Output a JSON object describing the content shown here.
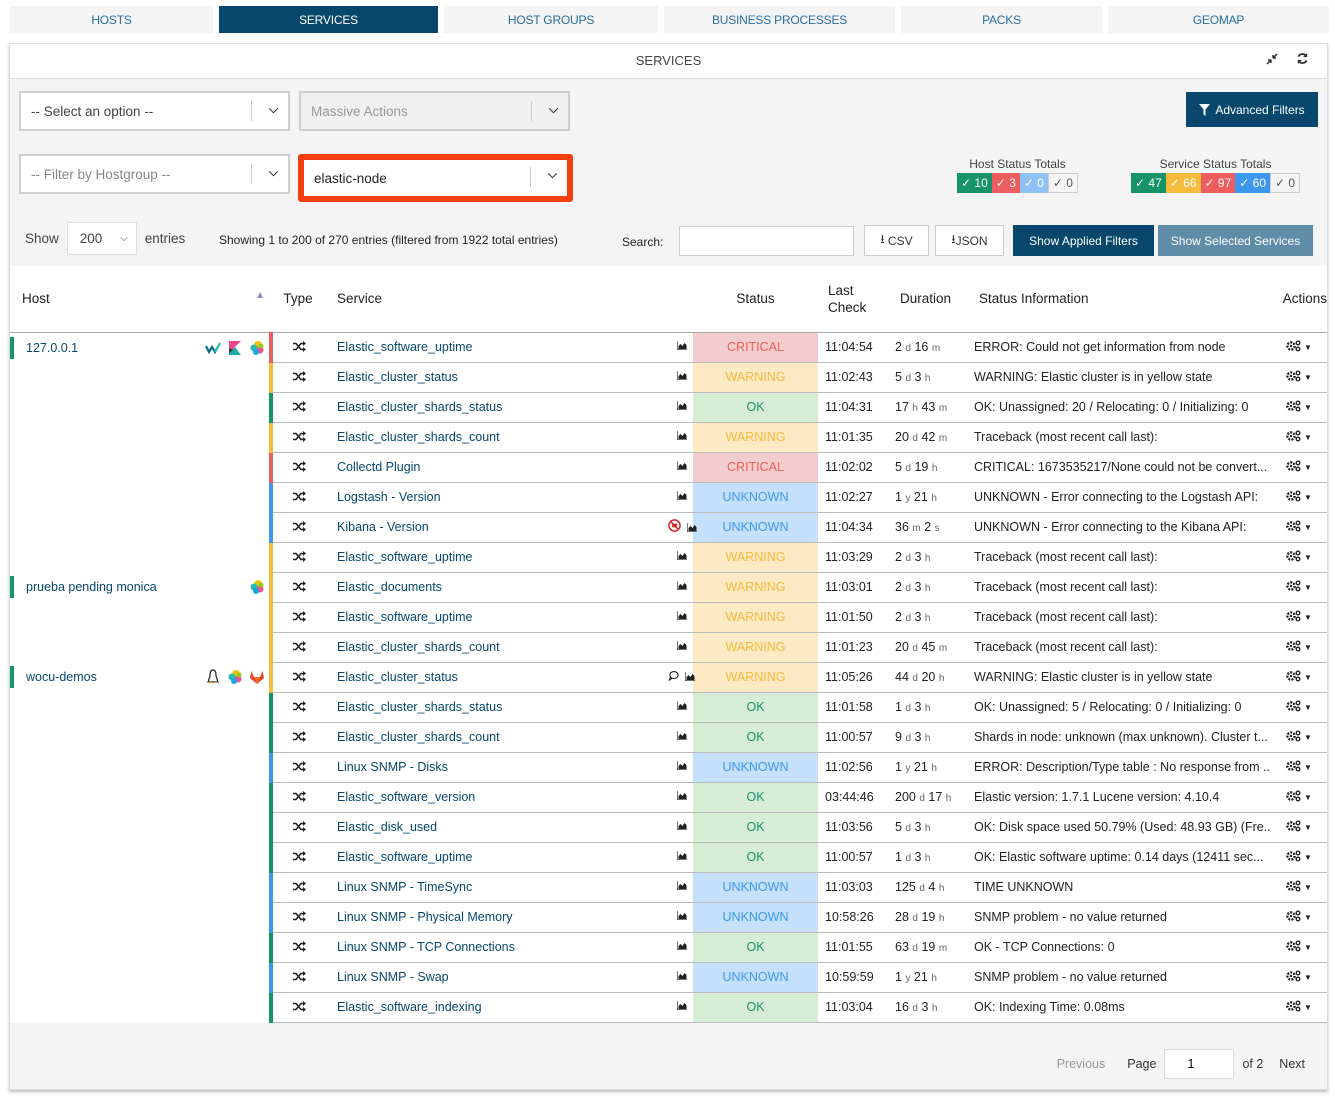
{
  "nav": {
    "tabs": [
      {
        "label": "HOSTS",
        "active": false
      },
      {
        "label": "SERVICES",
        "active": true
      },
      {
        "label": "HOST GROUPS",
        "active": false
      },
      {
        "label": "BUSINESS PROCESSES",
        "active": false
      },
      {
        "label": "PACKS",
        "active": false
      },
      {
        "label": "GEOMAP",
        "active": false
      }
    ]
  },
  "panel": {
    "title": "SERVICES",
    "icons": [
      "compress-icon",
      "refresh-icon"
    ]
  },
  "filters": {
    "select_option": "-- Select an option --",
    "massive_actions": "Massive Actions",
    "hostgroup_placeholder": "-- Filter by Hostgroup --",
    "hostgroup_selected": "elastic-node",
    "advanced_filters_label": "Advanced Filters"
  },
  "host_totals": {
    "title": "Host Status Totals",
    "badges": [
      {
        "status": "up",
        "count": "10",
        "color": "#17936a"
      },
      {
        "status": "down",
        "count": "3",
        "color": "#ee5d5d"
      },
      {
        "status": "unreachable",
        "count": "0",
        "color": "#8ec2f5"
      },
      {
        "status": "pending",
        "count": "0",
        "color": "#f4f4f4"
      }
    ]
  },
  "service_totals": {
    "title": "Service Status Totals",
    "badges": [
      {
        "status": "ok",
        "count": "47",
        "color": "#17936a"
      },
      {
        "status": "warning",
        "count": "66",
        "color": "#f4bb3c"
      },
      {
        "status": "critical",
        "count": "97",
        "color": "#ee5d5d"
      },
      {
        "status": "unknown",
        "count": "60",
        "color": "#3c97ee"
      },
      {
        "status": "pending",
        "count": "0",
        "color": "#f4f4f4"
      }
    ]
  },
  "table_controls": {
    "show_label": "Show",
    "entries_value": "200",
    "entries_label": "entries",
    "info": "Showing 1 to 200 of 270 entries (filtered from 1922 total entries)",
    "search_label": "Search:",
    "search_value": "",
    "csv_label": "CSV",
    "json_label": "JSON",
    "show_applied_filters": "Show Applied Filters",
    "show_selected_services": "Show Selected Services"
  },
  "columns": {
    "host": "Host",
    "type": "Type",
    "service": "Service",
    "status": "Status",
    "last_check_1": "Last",
    "last_check_2": "Check",
    "duration": "Duration",
    "status_information": "Status Information",
    "actions": "Actions"
  },
  "host_groups": [
    {
      "host": "127.0.0.1",
      "icons": [
        "wocu-icon",
        "kibana-icon",
        "elastic-icon"
      ],
      "services": [
        {
          "name": "Elastic_software_uptime",
          "status": "CRITICAL",
          "last_check": "11:04:54",
          "duration": [
            [
              "2",
              "d"
            ],
            [
              "16",
              "m"
            ]
          ],
          "info": "ERROR: Could not get information from node",
          "extra": []
        },
        {
          "name": "Elastic_cluster_status",
          "status": "WARNING",
          "last_check": "11:02:43",
          "duration": [
            [
              "5",
              "d"
            ],
            [
              "3",
              "h"
            ]
          ],
          "info": "WARNING: Elastic cluster is in yellow state",
          "extra": []
        },
        {
          "name": "Elastic_cluster_shards_status",
          "status": "OK",
          "last_check": "11:04:31",
          "duration": [
            [
              "17",
              "h"
            ],
            [
              "43",
              "m"
            ]
          ],
          "info": "OK: Unassigned: 20 / Relocating: 0 / Initializing: 0",
          "extra": []
        },
        {
          "name": "Elastic_cluster_shards_count",
          "status": "WARNING",
          "last_check": "11:01:35",
          "duration": [
            [
              "20",
              "d"
            ],
            [
              "42",
              "m"
            ]
          ],
          "info": "Traceback (most recent call last):",
          "extra": []
        },
        {
          "name": "Collectd Plugin",
          "status": "CRITICAL",
          "last_check": "11:02:02",
          "duration": [
            [
              "5",
              "d"
            ],
            [
              "19",
              "h"
            ]
          ],
          "info": "CRITICAL: 1673535217/None could not be convert...",
          "extra": []
        },
        {
          "name": "Logstash - Version",
          "status": "UNKNOWN",
          "last_check": "11:02:27",
          "duration": [
            [
              "1",
              "y"
            ],
            [
              "21",
              "h"
            ]
          ],
          "info": "UNKNOWN - Error connecting to the Logstash API:",
          "extra": []
        },
        {
          "name": "Kibana - Version",
          "status": "UNKNOWN",
          "last_check": "11:04:34",
          "duration": [
            [
              "36",
              "m"
            ],
            [
              "2",
              "s"
            ]
          ],
          "info": "UNKNOWN - Error connecting to the Kibana API:",
          "extra": [
            "notifications-disabled-icon"
          ]
        },
        {
          "name": "Elastic_software_uptime",
          "status": "WARNING",
          "last_check": "11:03:29",
          "duration": [
            [
              "2",
              "d"
            ],
            [
              "3",
              "h"
            ]
          ],
          "info": "Traceback (most recent call last):",
          "extra": []
        }
      ]
    },
    {
      "host": "prueba pending monica",
      "icons": [
        "elastic-icon"
      ],
      "services": [
        {
          "name": "Elastic_documents",
          "status": "WARNING",
          "last_check": "11:03:01",
          "duration": [
            [
              "2",
              "d"
            ],
            [
              "3",
              "h"
            ]
          ],
          "info": "Traceback (most recent call last):",
          "extra": []
        },
        {
          "name": "Elastic_software_uptime",
          "status": "WARNING",
          "last_check": "11:01:50",
          "duration": [
            [
              "2",
              "d"
            ],
            [
              "3",
              "h"
            ]
          ],
          "info": "Traceback (most recent call last):",
          "extra": []
        },
        {
          "name": "Elastic_cluster_shards_count",
          "status": "WARNING",
          "last_check": "11:01:23",
          "duration": [
            [
              "20",
              "d"
            ],
            [
              "45",
              "m"
            ]
          ],
          "info": "Traceback (most recent call last):",
          "extra": []
        }
      ]
    },
    {
      "host": "wocu-demos",
      "icons": [
        "linux-icon",
        "elastic-icon",
        "gitlab-icon"
      ],
      "services": [
        {
          "name": "Elastic_cluster_status",
          "status": "WARNING",
          "last_check": "11:05:26",
          "duration": [
            [
              "44",
              "d"
            ],
            [
              "20",
              "h"
            ]
          ],
          "info": "WARNING: Elastic cluster is in yellow state",
          "extra": [
            "comment-icon"
          ]
        },
        {
          "name": "Elastic_cluster_shards_status",
          "status": "OK",
          "last_check": "11:01:58",
          "duration": [
            [
              "1",
              "d"
            ],
            [
              "3",
              "h"
            ]
          ],
          "info": "OK: Unassigned: 5 / Relocating: 0 / Initializing: 0",
          "extra": []
        },
        {
          "name": "Elastic_cluster_shards_count",
          "status": "OK",
          "last_check": "11:00:57",
          "duration": [
            [
              "9",
              "d"
            ],
            [
              "3",
              "h"
            ]
          ],
          "info": "Shards in node: unknown (max unknown). Cluster t...",
          "extra": []
        },
        {
          "name": "Linux SNMP - Disks",
          "status": "UNKNOWN",
          "last_check": "11:02:56",
          "duration": [
            [
              "1",
              "y"
            ],
            [
              "21",
              "h"
            ]
          ],
          "info": "ERROR: Description/Type table : No response from ...",
          "extra": []
        },
        {
          "name": "Elastic_software_version",
          "status": "OK",
          "last_check": "03:44:46",
          "duration": [
            [
              "200",
              "d"
            ],
            [
              "17",
              "h"
            ]
          ],
          "info": "Elastic version: 1.7.1 Lucene version: 4.10.4",
          "extra": []
        },
        {
          "name": "Elastic_disk_used",
          "status": "OK",
          "last_check": "11:03:56",
          "duration": [
            [
              "5",
              "d"
            ],
            [
              "3",
              "h"
            ]
          ],
          "info": "OK: Disk space used 50.79% (Used: 48.93 GB) (Fre...",
          "extra": []
        },
        {
          "name": "Elastic_software_uptime",
          "status": "OK",
          "last_check": "11:00:57",
          "duration": [
            [
              "1",
              "d"
            ],
            [
              "3",
              "h"
            ]
          ],
          "info": "OK: Elastic software uptime: 0.14 days (12411 sec...",
          "extra": []
        },
        {
          "name": "Linux SNMP - TimeSync",
          "status": "UNKNOWN",
          "last_check": "11:03:03",
          "duration": [
            [
              "125",
              "d"
            ],
            [
              "4",
              "h"
            ]
          ],
          "info": "TIME UNKNOWN",
          "extra": []
        },
        {
          "name": "Linux SNMP - Physical Memory",
          "status": "UNKNOWN",
          "last_check": "10:58:26",
          "duration": [
            [
              "28",
              "d"
            ],
            [
              "19",
              "h"
            ]
          ],
          "info": "SNMP problem - no value returned",
          "extra": []
        },
        {
          "name": "Linux SNMP - TCP Connections",
          "status": "OK",
          "last_check": "11:01:55",
          "duration": [
            [
              "63",
              "d"
            ],
            [
              "19",
              "m"
            ]
          ],
          "info": "OK - TCP Connections: 0",
          "extra": []
        },
        {
          "name": "Linux SNMP - Swap",
          "status": "UNKNOWN",
          "last_check": "10:59:59",
          "duration": [
            [
              "1",
              "y"
            ],
            [
              "21",
              "h"
            ]
          ],
          "info": "SNMP problem - no value returned",
          "extra": []
        },
        {
          "name": "Elastic_software_indexing",
          "status": "OK",
          "last_check": "11:03:04",
          "duration": [
            [
              "16",
              "d"
            ],
            [
              "3",
              "h"
            ]
          ],
          "info": "OK: Indexing Time: 0.08ms",
          "extra": []
        }
      ]
    }
  ],
  "status_colors": {
    "CRITICAL": "#ee5d5d",
    "WARNING": "#f4bb3c",
    "OK": "#17936a",
    "UNKNOWN": "#3c97ee"
  },
  "pagination": {
    "previous": "Previous",
    "page_label": "Page",
    "current_page": "1",
    "of_label": "of 2",
    "next": "Next"
  }
}
